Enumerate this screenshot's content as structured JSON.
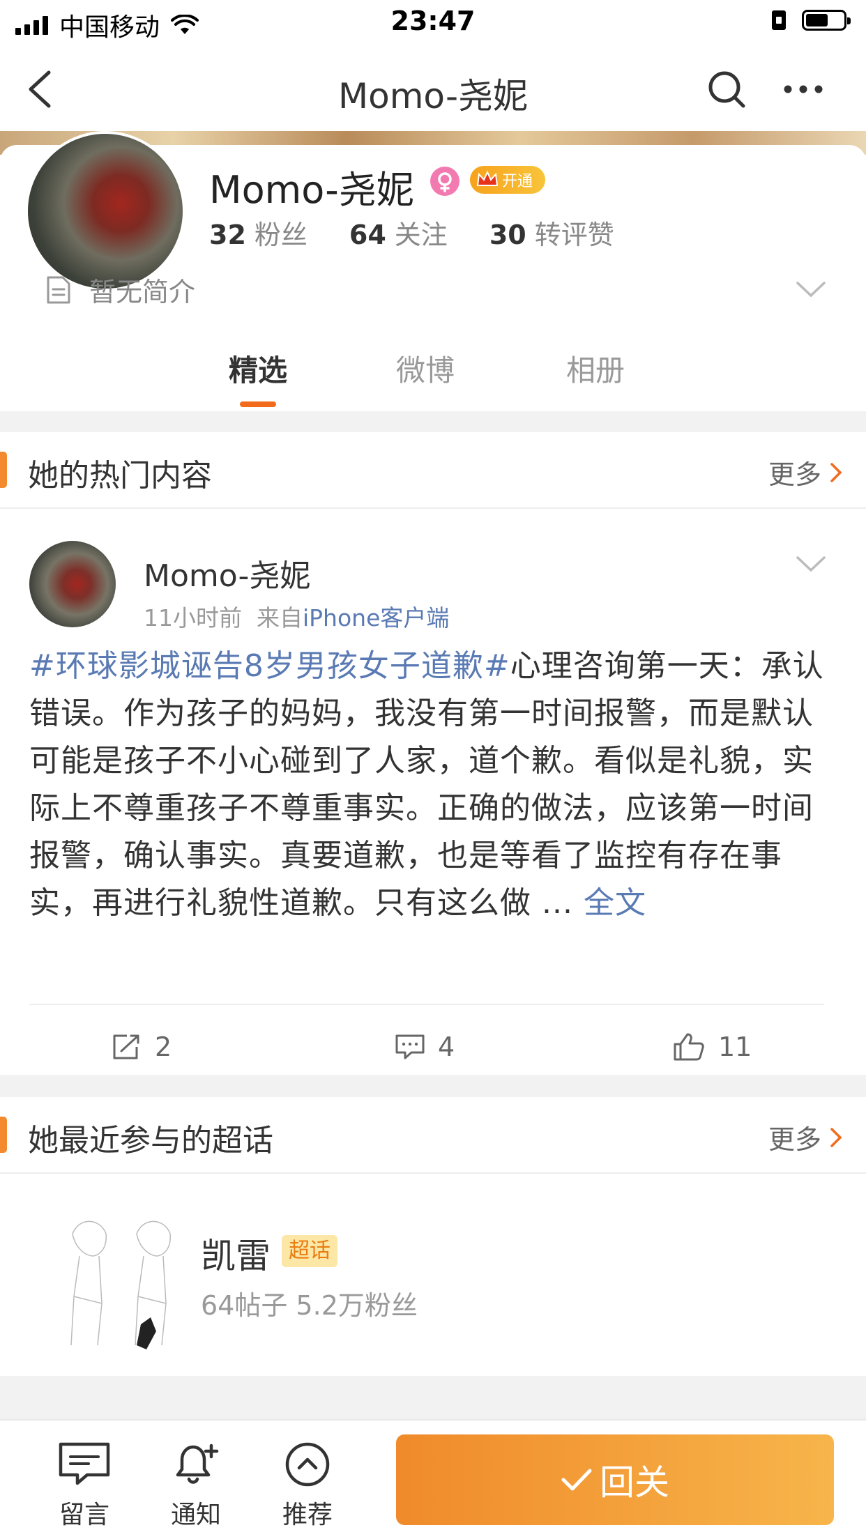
{
  "status_bar": {
    "carrier": "中国移动",
    "time": "23:47",
    "battery_level": 0.6
  },
  "nav": {
    "title": "Momo-尧妮",
    "icons": [
      "back-arrow-icon",
      "search-icon",
      "more-icon"
    ]
  },
  "profile": {
    "name": "Momo-尧妮",
    "vip_label": "开通",
    "stats": [
      {
        "value": "32",
        "label": "粉丝"
      },
      {
        "value": "64",
        "label": "关注"
      },
      {
        "value": "30",
        "label": "转评赞"
      }
    ],
    "bio": "暂无简介"
  },
  "tabs": [
    {
      "label": "精选",
      "active": true
    },
    {
      "label": "微博",
      "active": false
    },
    {
      "label": "相册",
      "active": false
    }
  ],
  "hot_section": {
    "title": "她的热门内容",
    "more": "更多"
  },
  "post": {
    "author": "Momo-尧妮",
    "time": "11小时前",
    "source_prefix": "来自",
    "source": "iPhone客户端",
    "hashtag": "#环球影城诬告8岁男孩女子道歉#",
    "body": "心理咨询第一天：承认错误。作为孩子的妈妈，我没有第一时间报警，而是默认可能是孩子不小心碰到了人家，道个歉。看似是礼貌，实际上不尊重孩子不尊重事实。正确的做法，应该第一时间报警，确认事实。真要道歉，也是等看了监控有存在事实，再进行礼貌性道歉。只有这么做 ...",
    "full_text_link": "全文",
    "reposts": "2",
    "comments": "4",
    "likes": "11"
  },
  "topic_section": {
    "title": "她最近参与的超话",
    "more": "更多",
    "topic": {
      "name": "凯雷",
      "badge": "超话",
      "meta": "64帖子 5.2万粉丝"
    }
  },
  "bottom_bar": {
    "message": "留言",
    "notify": "通知",
    "recommend": "推荐",
    "follow_back": "回关"
  },
  "colors": {
    "accent": "#f26b1d",
    "link": "#5a7ab3",
    "follow_gradient_start": "#f08a2a",
    "follow_gradient_end": "#f7b54a"
  }
}
